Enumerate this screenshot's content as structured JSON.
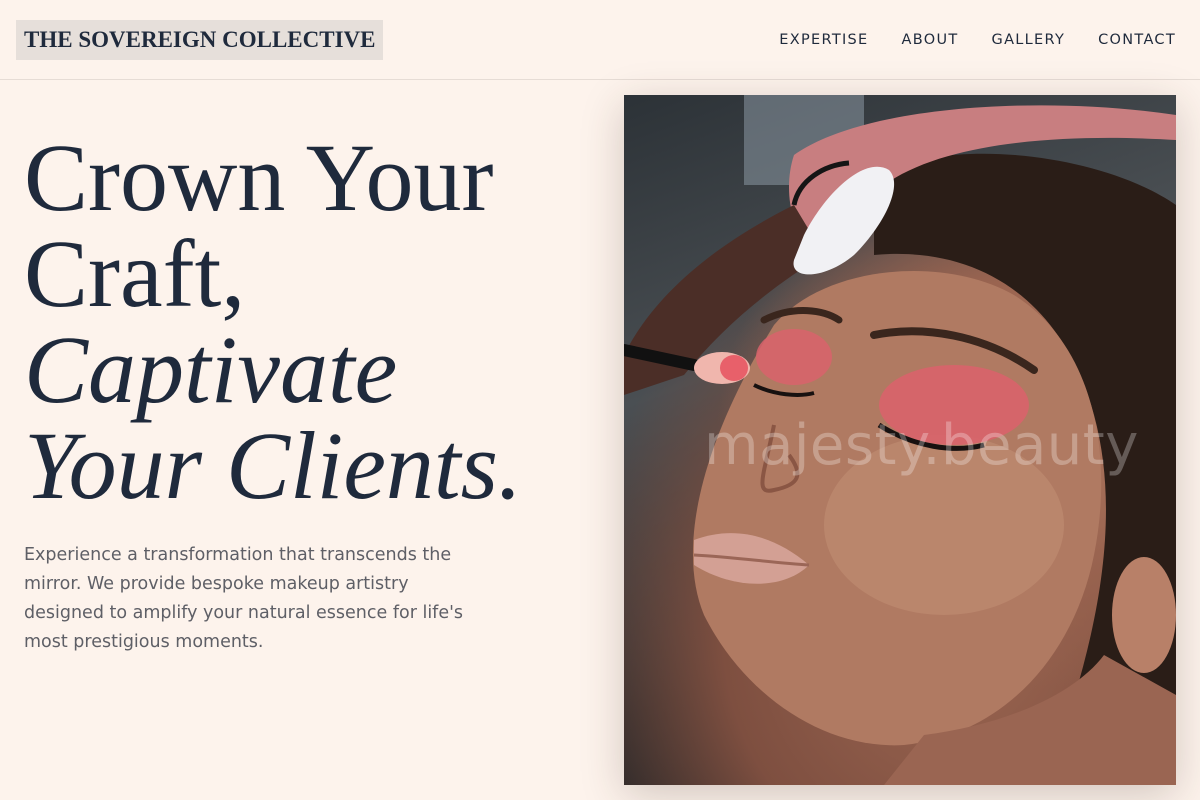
{
  "header": {
    "brand": "THE SOVEREIGN COLLECTIVE",
    "nav": [
      {
        "label": "EXPERTISE"
      },
      {
        "label": "ABOUT"
      },
      {
        "label": "GALLERY"
      },
      {
        "label": "CONTACT"
      }
    ]
  },
  "hero": {
    "title_line1": "Crown Your",
    "title_line2": "Craft,",
    "title_line3": "Captivate",
    "title_line4": "Your Clients.",
    "description": "Experience a transformation that transcends the mirror. We provide bespoke makeup artistry designed to amplify your natural essence for life's most prestigious moments.",
    "image": {
      "alt": "Makeup artist applying pink eyeshadow to a model with closed eyes",
      "watermark": "majesty.beauty"
    }
  },
  "colors": {
    "background": "#fdf3ec",
    "text": "#1f2a3c",
    "muted_text": "#5e5f66",
    "logo_bg": "#e6dfda"
  }
}
